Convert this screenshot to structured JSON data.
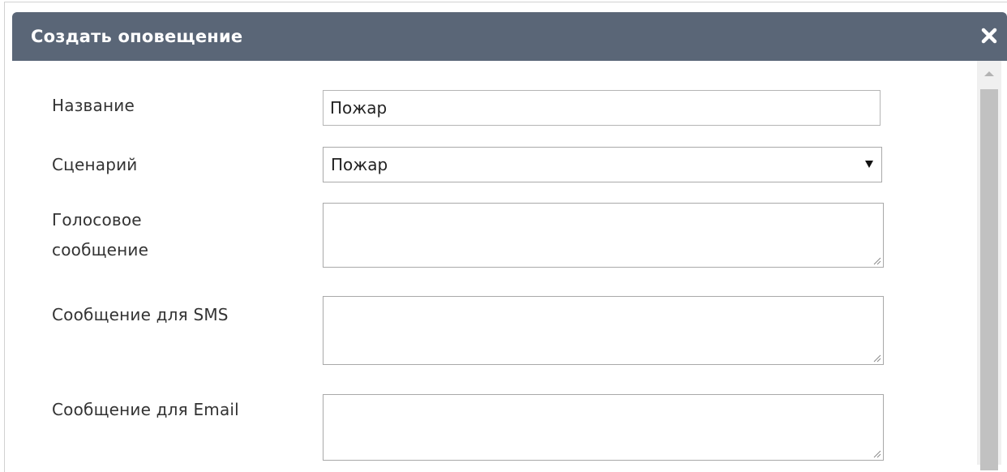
{
  "dialog": {
    "title": "Создать оповещение",
    "close_icon": "close-icon"
  },
  "form": {
    "name_label": "Название",
    "name_value": "Пожар",
    "scenario_label": "Сценарий",
    "scenario_value": "Пожар",
    "voice_label_line1": "Голосовое",
    "voice_label_line2": "сообщение",
    "voice_value": "",
    "sms_label": "Сообщение для SMS",
    "sms_value": "",
    "email_label": "Сообщение для Email",
    "email_value": ""
  },
  "colors": {
    "header_bg": "#5a6677",
    "header_text": "#ffffff",
    "scroll_thumb": "#c1c1c1"
  }
}
